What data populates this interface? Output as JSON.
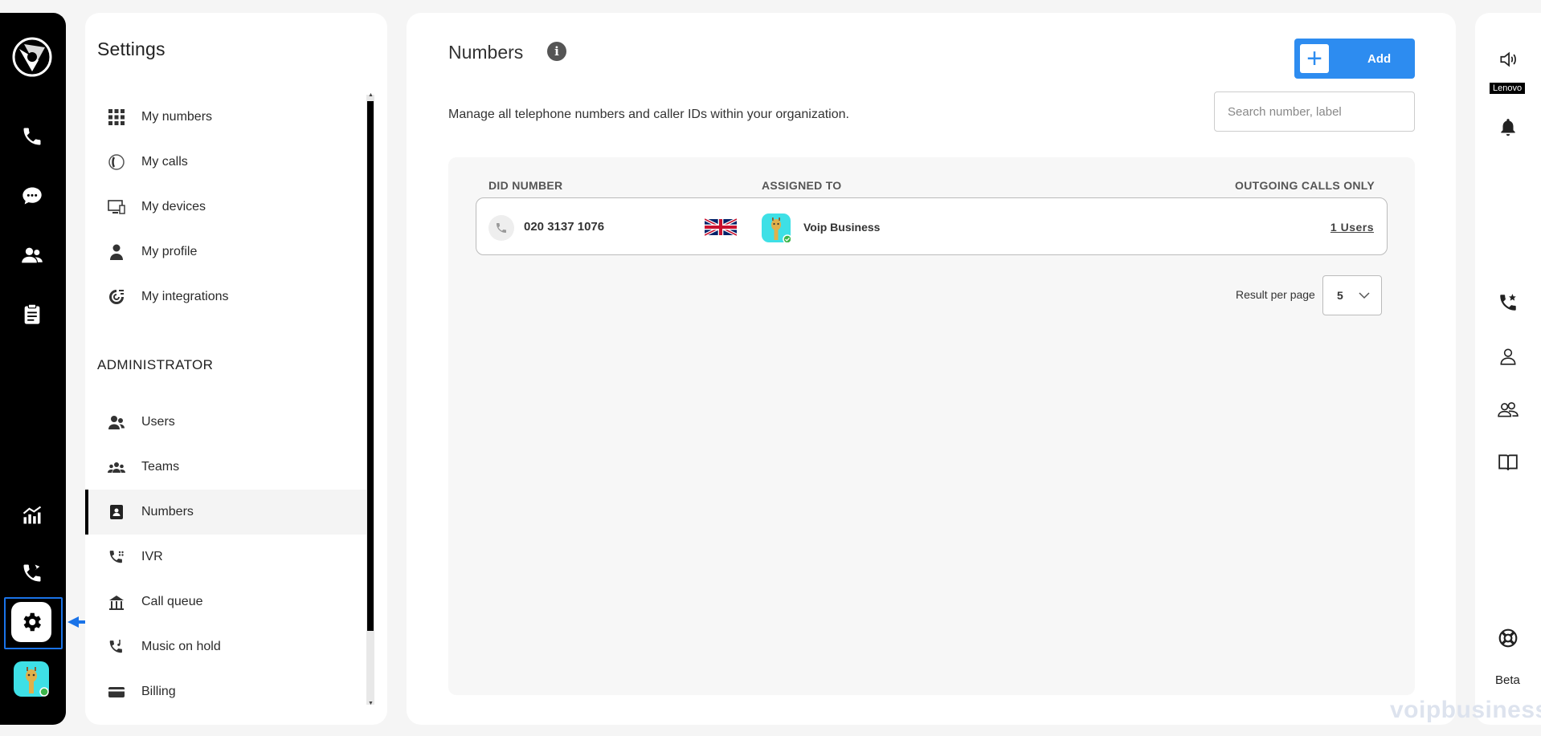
{
  "settings": {
    "title": "Settings",
    "personal_items": [
      {
        "label": "My numbers",
        "icon": "grid-icon"
      },
      {
        "label": "My calls",
        "icon": "calls-icon"
      },
      {
        "label": "My devices",
        "icon": "devices-icon"
      },
      {
        "label": "My profile",
        "icon": "profile-icon"
      },
      {
        "label": "My integrations",
        "icon": "integrations-icon"
      }
    ],
    "admin_heading": "ADMINISTRATOR",
    "admin_items": [
      {
        "label": "Users",
        "icon": "users-icon"
      },
      {
        "label": "Teams",
        "icon": "teams-icon"
      },
      {
        "label": "Numbers",
        "icon": "numbers-icon",
        "active": true
      },
      {
        "label": "IVR",
        "icon": "ivr-icon"
      },
      {
        "label": "Call queue",
        "icon": "call-queue-icon"
      },
      {
        "label": "Music on hold",
        "icon": "music-on-hold-icon"
      },
      {
        "label": "Billing",
        "icon": "billing-icon"
      }
    ]
  },
  "main": {
    "title": "Numbers",
    "description": "Manage all telephone numbers and caller IDs within your organization.",
    "add_label": "Add",
    "search_placeholder": "Search number, label",
    "columns": {
      "did": "DID NUMBER",
      "assigned": "ASSIGNED TO",
      "outgoing": "OUTGOING CALLS ONLY"
    },
    "rows": [
      {
        "number": "020 3137 1076",
        "country": "uk-flag",
        "assigned_to": "Voip Business",
        "users": "1 Users"
      }
    ],
    "result_per_page_label": "Result per page",
    "result_per_page": "5"
  },
  "right_rail": {
    "device_label": "Lenovo",
    "beta_label": "Beta"
  },
  "watermark": "voipbusiness",
  "colors": {
    "accent": "#2d8cf0",
    "rail": "#000000",
    "avatar_bg": "#3ee0e6",
    "online": "#3cb54a"
  }
}
